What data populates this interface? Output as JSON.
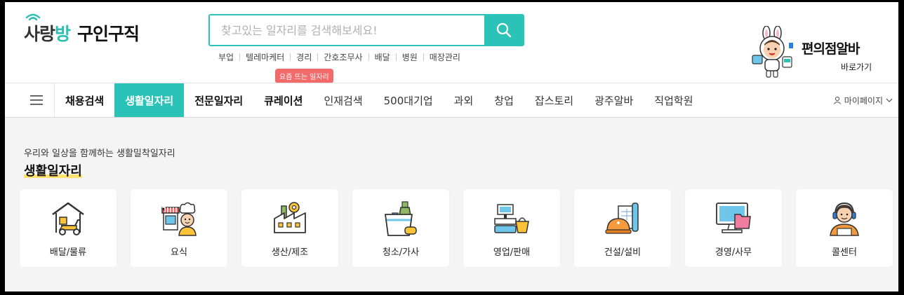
{
  "header": {
    "logo_brand_a": "사랑",
    "logo_brand_b": "방",
    "logo_sub": "구인구직",
    "search_placeholder": "찾고있는 일자리를 검색해보세요!",
    "keywords": [
      "부업",
      "텔레마케터",
      "경리",
      "간호조무사",
      "배달",
      "병원",
      "매장관리"
    ],
    "promo_title": "편의점알바",
    "promo_sub": "바로가기"
  },
  "nav": {
    "tooltip": "요즘 뜨는 일자리",
    "items": [
      {
        "label": "채용검색"
      },
      {
        "label": "생활일자리"
      },
      {
        "label": "전문일자리"
      },
      {
        "label": "큐레이션"
      },
      {
        "label": "인재검색"
      },
      {
        "label": "500대기업"
      },
      {
        "label": "과외"
      },
      {
        "label": "창업"
      },
      {
        "label": "잡스토리"
      },
      {
        "label": "광주알바"
      },
      {
        "label": "직업학원"
      }
    ],
    "mypage": "마이페이지"
  },
  "section": {
    "intro": "우리와 일상을 함께하는 생활밀착일자리",
    "title": "생활일자리",
    "categories": [
      {
        "label": "배달/물류",
        "icon": "delivery-scooter-icon"
      },
      {
        "label": "요식",
        "icon": "chef-restaurant-icon"
      },
      {
        "label": "생산/제조",
        "icon": "factory-icon"
      },
      {
        "label": "청소/가사",
        "icon": "cleaning-bucket-icon"
      },
      {
        "label": "영업/판매",
        "icon": "cash-register-icon"
      },
      {
        "label": "건설/설비",
        "icon": "hardhat-blueprint-icon"
      },
      {
        "label": "경영/사무",
        "icon": "office-monitor-icon"
      },
      {
        "label": "콜센터",
        "icon": "headset-agent-icon"
      }
    ]
  },
  "colors": {
    "accent": "#2bc3b7",
    "tooltip": "#f26a6a",
    "highlight": "#ffe36e"
  }
}
